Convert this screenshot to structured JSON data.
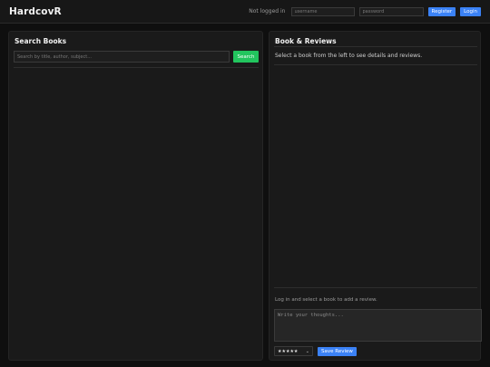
{
  "app": {
    "title": "HardcovR"
  },
  "auth": {
    "status": "Not logged in",
    "username_placeholder": "username",
    "password_placeholder": "password",
    "register_label": "Register",
    "login_label": "Login"
  },
  "search_panel": {
    "title": "Search Books",
    "input_placeholder": "Search by title, author, subject...",
    "button_label": "Search"
  },
  "details_panel": {
    "title": "Book & Reviews",
    "hint": "Select a book from the left to see details and reviews.",
    "review_note": "Log in and select a book to add a review.",
    "review_placeholder": "Write your thoughts...",
    "rating_value": "★★★★★",
    "save_label": "Save Review"
  },
  "colors": {
    "accent_blue": "#3b82f6",
    "accent_green": "#22c55e",
    "background": "#0f0f0f",
    "panel": "#1a1a1a"
  }
}
